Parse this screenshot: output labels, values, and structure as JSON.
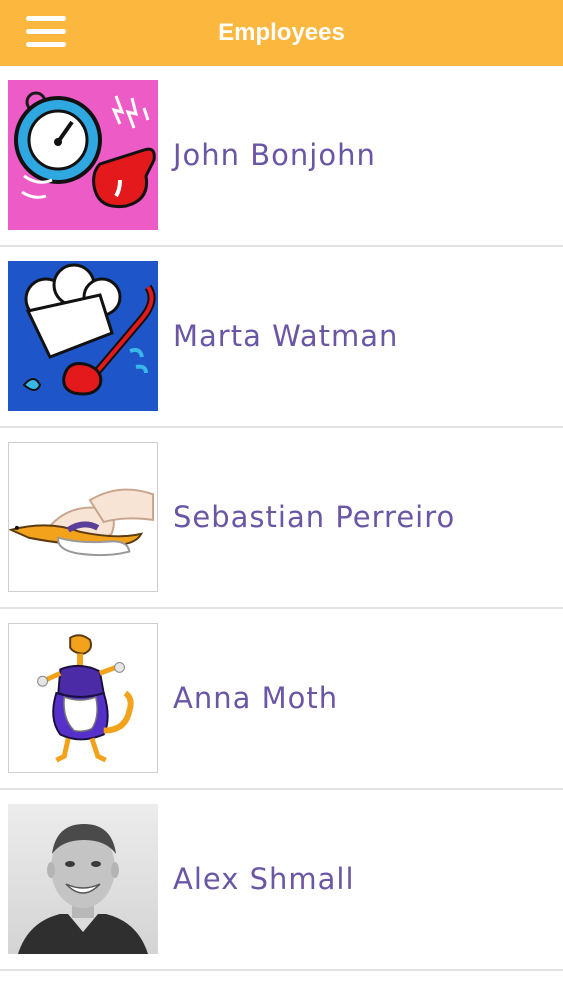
{
  "header": {
    "title": "Employees",
    "menu_icon": "hamburger-menu-icon",
    "background_color": "#FBB73E"
  },
  "employees": [
    {
      "name": "John Bonjohn",
      "avatar": "stopwatch-and-whistle-illustration"
    },
    {
      "name": "Marta Watman",
      "avatar": "chef-hat-and-ladle-illustration"
    },
    {
      "name": "Sebastian Perreiro",
      "avatar": "hands-massaging-lizard-illustration"
    },
    {
      "name": "Anna Moth",
      "avatar": "lizard-maid-illustration"
    },
    {
      "name": "Alex Shmall",
      "avatar": "smiling-man-photo"
    }
  ],
  "colors": {
    "name_text": "#6B56A6",
    "divider": "#e3e3e3"
  }
}
